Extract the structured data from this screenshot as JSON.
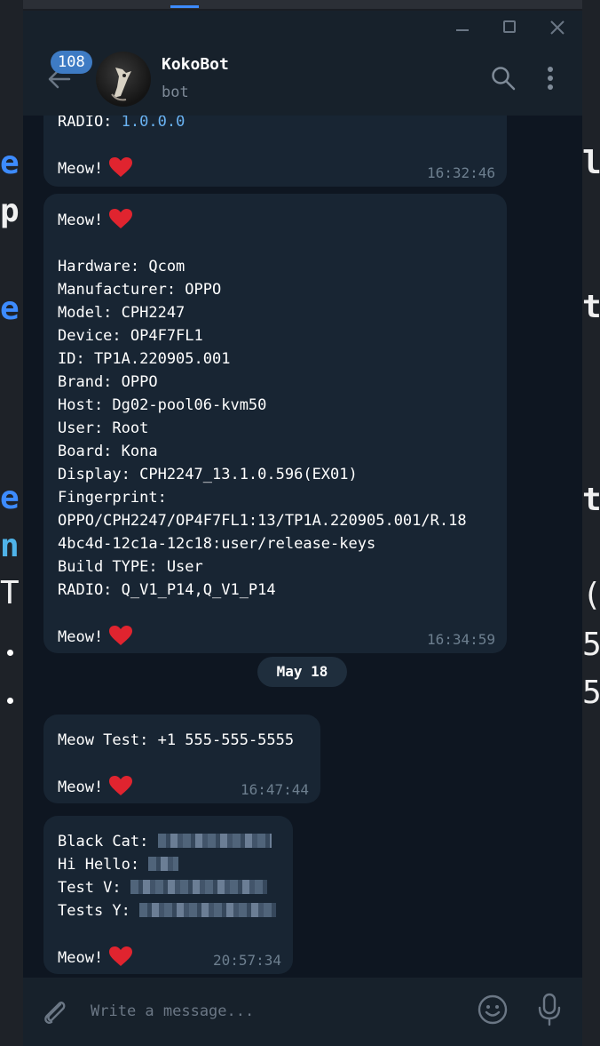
{
  "chat": {
    "unread_count": "108",
    "name": "KokoBot",
    "status": "bot"
  },
  "messages": [
    {
      "text": "RADIO: 1.0.0.0\n\nMeow!",
      "time": "16:32:46"
    },
    {
      "text": "Meow!\n\nHardware: Qcom\nManufacturer: OPPO\nModel: CPH2247\nDevice: OP4F7FL1\nID: TP1A.220905.001\nBrand: OPPO\nHost: Dg02-pool06-kvm50\nUser: Root\nBoard: Kona\nDisplay: CPH2247_13.1.0.596(EX01)\nFingerprint:\nOPPO/CPH2247/OP4F7FL1:13/TP1A.220905.001/R.18\n4bc4d-12c1a-12c18:user/release-keys\nBuild TYPE: User\nRADIO: Q_V1_P14,Q_V1_P14\n\nMeow!",
      "time": "16:34:59"
    },
    {
      "text": "Meow Test: +1 555-555-5555\n\nMeow!",
      "time": "16:47:44"
    },
    {
      "text": "Black Cat: \nHi Hello: \nTest V: \nTests Y: \n\nMeow!",
      "time": "20:57:34"
    }
  ],
  "date_separator": "May 18",
  "composer": {
    "placeholder": "Write a message..."
  },
  "colors": {
    "chat_background": "#0e1621",
    "bubble": "#182533",
    "header": "#17212b",
    "badge": "#3e7bc4",
    "heart": "#e0242f"
  }
}
